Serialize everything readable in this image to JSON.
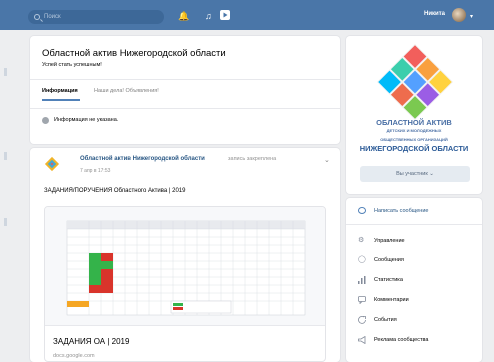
{
  "header": {
    "search_placeholder": "Поиск",
    "user_name": "Никита",
    "icons": [
      "search-icon",
      "bell-icon",
      "music-icon",
      "play-icon"
    ]
  },
  "group": {
    "title": "Областной актив Нижегородской области",
    "status": "Успей стать успешным!",
    "tabs": [
      {
        "label": "Информация",
        "active": true
      },
      {
        "label": "Наши дела! Объявления!",
        "active": false
      }
    ],
    "info_text": "Информация не указана."
  },
  "post": {
    "author": "Областной актив Нижегородской области",
    "pinned_label": "запись закреплена",
    "date": "7 апр в 17:53",
    "text": "ЗАДАНИЯ/ПОРУЧЕНИЯ Областного Актива | 2019",
    "attachment_title": "ЗАДАНИЯ ОА | 2019",
    "attachment_url": "docs.google.com"
  },
  "sidebar": {
    "logo_line1": "ОБЛАСТНОЙ АКТИВ",
    "logo_line2": "ДЕТСКИХ И МОЛОДЕЖНЫХ",
    "logo_line3": "ОБЩЕСТВЕННЫХ ОРГАНИЗАЦИЙ",
    "logo_line4": "НИЖЕГОРОДСКОЙ ОБЛАСТИ",
    "member_button": "Вы участник",
    "write_message": "Написать сообщение",
    "menu": [
      {
        "label": "Управление",
        "icon": "gear-icon"
      },
      {
        "label": "Сообщения",
        "icon": "chat-icon"
      },
      {
        "label": "Статистика",
        "icon": "chart-icon"
      },
      {
        "label": "Комментарии",
        "icon": "comment-icon"
      },
      {
        "label": "События",
        "icon": "event-icon"
      },
      {
        "label": "Реклама сообщества",
        "icon": "megaphone-icon"
      }
    ]
  },
  "colors": {
    "header_bg": "#4a76a8",
    "link": "#2a5885",
    "page_bg": "#edeef0"
  }
}
